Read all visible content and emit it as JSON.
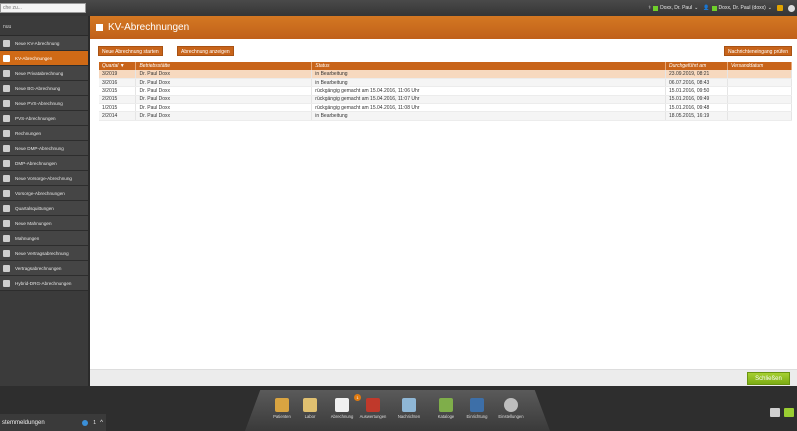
{
  "topbar": {
    "search_placeholder": "che zu...",
    "doctor_label": "Doxx, Dr. Paul",
    "user_label": "Doxx, Dr. Paul (doxx)"
  },
  "sidebar": {
    "heading": "nuu",
    "items": [
      {
        "label": "Neue KV-Abrechnung"
      },
      {
        "label": "KV-Abrechnungen"
      },
      {
        "label": "Neue Privatabrechnung"
      },
      {
        "label": "Neue BG-Abrechnung"
      },
      {
        "label": "Neue PVS-Abrechnung"
      },
      {
        "label": "PVS-Abrechnungen"
      },
      {
        "label": "Rechnungen"
      },
      {
        "label": "Neue DMP-Abrechnung"
      },
      {
        "label": "DMP-Abrechnungen"
      },
      {
        "label": "Neue Vorsorge-Abrechnung"
      },
      {
        "label": "Vorsorge-Abrechnungen"
      },
      {
        "label": "Quartalsquittungen"
      },
      {
        "label": "Neue Mahnungen"
      },
      {
        "label": "Mahnungen"
      },
      {
        "label": "Neue Vertragsabrechnung"
      },
      {
        "label": "Vertragsabrechnungen"
      },
      {
        "label": "Hybrid-DRG-Abrechnungen"
      }
    ]
  },
  "main": {
    "title": "KV-Abrechnungen",
    "btn_new": "Neue Abrechnung starten",
    "btn_show": "Abrechnung anzeigen",
    "btn_check": "Nachrichteneingang prüfen",
    "columns": [
      "Quartal",
      "Betriebsstätte",
      "Status",
      "Durchgeführt am",
      "Versanddatum"
    ],
    "rows": [
      [
        "3/2019",
        "Dr. Paul Doxx",
        "in Bearbeitung",
        "23.09.2019, 08:21",
        ""
      ],
      [
        "3/2016",
        "Dr. Paul Doxx",
        "in Bearbeitung",
        "06.07.2016, 08:43",
        ""
      ],
      [
        "3/2015",
        "Dr. Paul Doxx",
        "rückgängig gemacht am 15.04.2016, 11:06 Uhr",
        "15.01.2016, 09:50",
        ""
      ],
      [
        "2/2015",
        "Dr. Paul Doxx",
        "rückgängig gemacht am 15.04.2016, 11:07 Uhr",
        "15.01.2016, 09:49",
        ""
      ],
      [
        "1/2015",
        "Dr. Paul Doxx",
        "rückgängig gemacht am 15.04.2016, 11:08 Uhr",
        "15.01.2016, 09:48",
        ""
      ],
      [
        "2/2014",
        "Dr. Paul Doxx",
        "in Bearbeitung",
        "18.05.2015, 16:19",
        ""
      ]
    ],
    "close_label": "Schließen"
  },
  "dock": {
    "items": [
      {
        "label": "Patienten",
        "color": "#d9a441"
      },
      {
        "label": "Labor",
        "color": "#e0c070"
      },
      {
        "label": "Abrechnung",
        "color": "#f0f0f0",
        "badge": "1"
      },
      {
        "label": "Auswertungen",
        "color": "#c0392b"
      },
      {
        "label": "Nachrichten",
        "color": "#8fb7d6"
      },
      {
        "label": "Kataloge",
        "color": "#7fae4a"
      },
      {
        "label": "Einrichtung",
        "color": "#3d6fa8"
      },
      {
        "label": "Einstellungen",
        "color": "#bdbdbd"
      }
    ],
    "sysmsg_label": "stemmeldungen",
    "sysmsg_count": "1"
  },
  "colors": {
    "accent": "#c8641a",
    "active_sidebar": "#d06a16",
    "close_button": "#8cbc1e"
  }
}
